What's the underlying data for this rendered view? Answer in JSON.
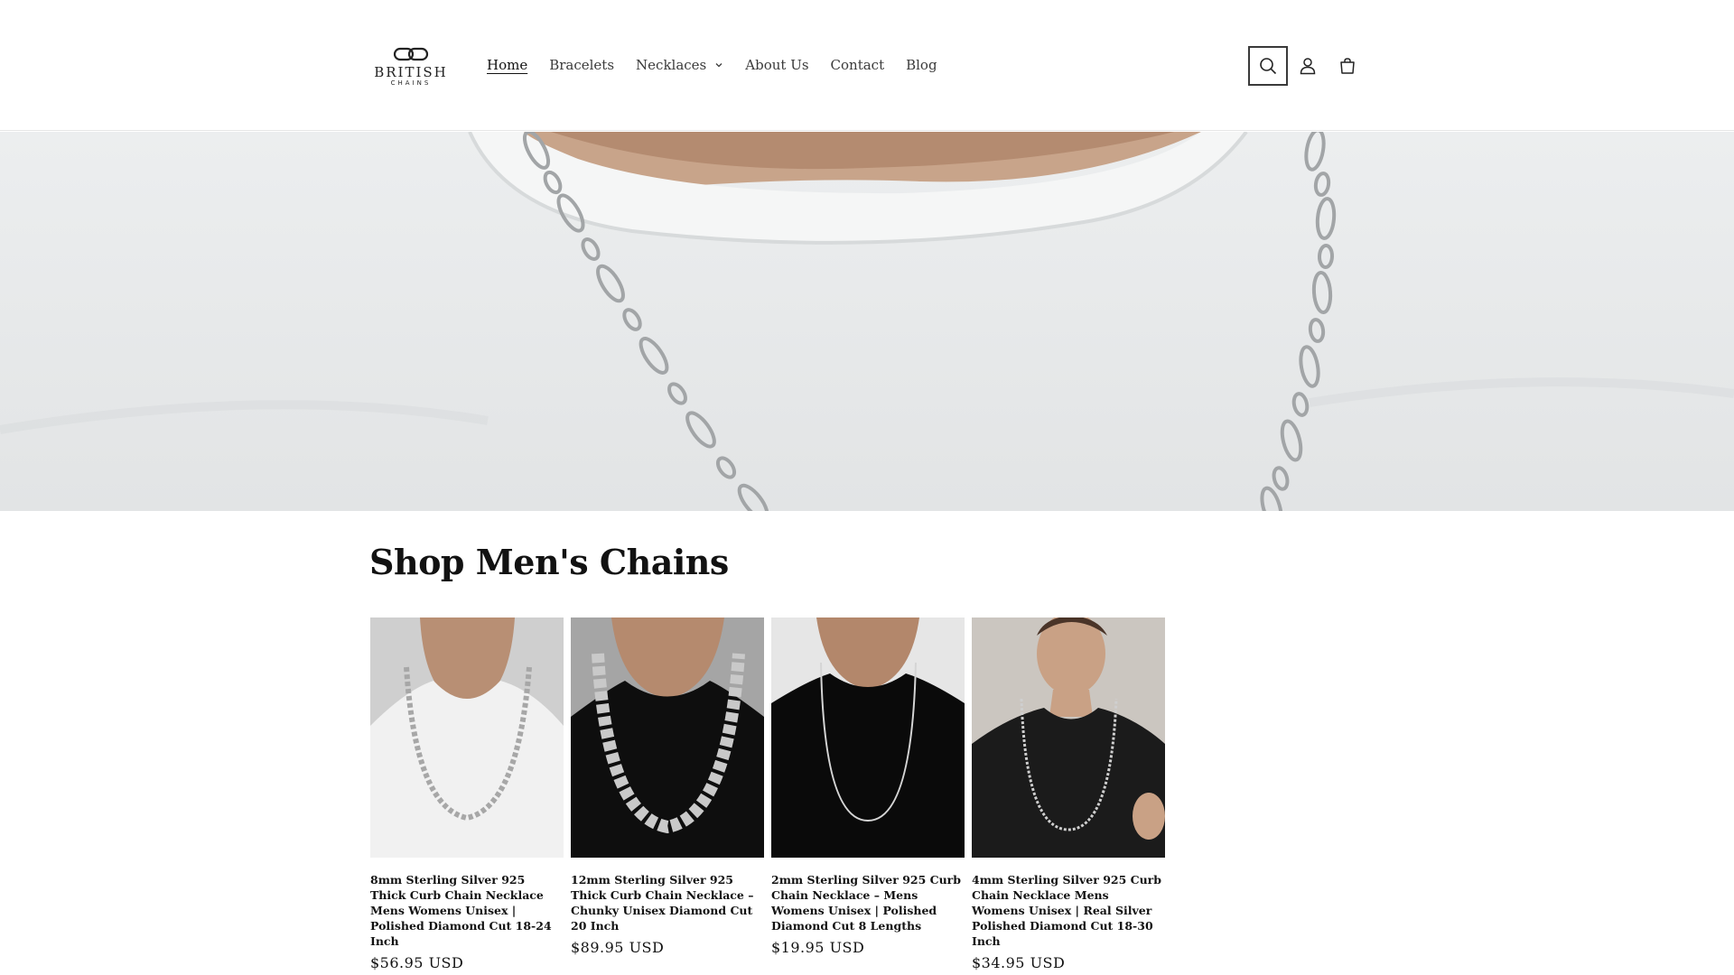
{
  "header": {
    "logo": {
      "brand": "BRITISH",
      "sub": "CHAINS"
    },
    "nav": [
      {
        "label": "Home",
        "active": true
      },
      {
        "label": "Bracelets"
      },
      {
        "label": "Necklaces",
        "dropdown": true
      },
      {
        "label": "About Us"
      },
      {
        "label": "Contact"
      },
      {
        "label": "Blog"
      }
    ],
    "icons": [
      "search-icon",
      "account-icon",
      "cart-icon"
    ]
  },
  "hero": {
    "image": "close-up of silver figaro chain on white t-shirt"
  },
  "section": {
    "title": "Shop Men's Chains",
    "products": [
      {
        "title": "8mm Sterling Silver 925 Thick Curb Chain Necklace Mens Womens Unisex | Polished Diamond Cut 18-24 Inch",
        "price": "$56.95 USD",
        "shirt": "#f3f3f3",
        "bg": "#d9d9d9"
      },
      {
        "title": "12mm Sterling Silver 925 Thick Curb Chain Necklace – Chunky Unisex Diamond Cut 20 Inch",
        "price": "$89.95 USD",
        "shirt": "#0e0e0e",
        "bg": "#a9a9a9"
      },
      {
        "title": "2mm Sterling Silver 925 Curb Chain Necklace – Mens Womens Unisex | Polished Diamond Cut 8 Lengths",
        "price": "$19.95 USD",
        "shirt": "#0a0a0a",
        "bg": "#e8e8e8"
      },
      {
        "title": "4mm Sterling Silver 925 Curb Chain Necklace Mens Womens Unisex | Real Silver Polished Diamond Cut 18-30 Inch",
        "price": "$34.95 USD",
        "shirt": "#1b1b1b",
        "bg": "#cfcbc6"
      }
    ]
  },
  "colors": {
    "text": "#121212",
    "nav_text": "#3a3a3a",
    "divider": "#e6e6e6"
  }
}
